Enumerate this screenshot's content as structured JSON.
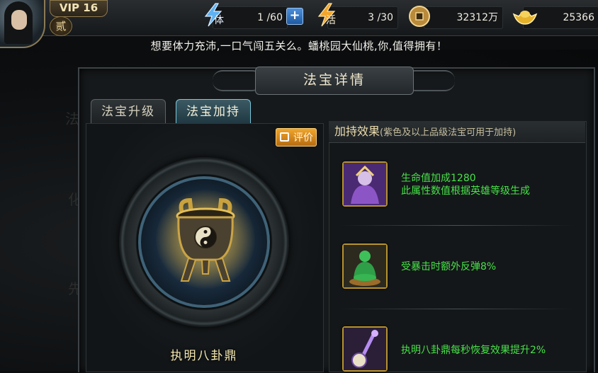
{
  "header": {
    "vip_label": "VIP 16",
    "rank_label": "贰",
    "stamina": {
      "icon": "stamina-bolt-icon",
      "label": "体",
      "value": "1 /60",
      "plus": "+"
    },
    "vigor": {
      "icon": "vigor-bolt-icon",
      "label": "活",
      "value": "3 /30"
    },
    "copper": {
      "icon": "copper-coin-icon",
      "value": "32312万"
    },
    "gold": {
      "icon": "gold-ingot-icon",
      "value": "25366"
    }
  },
  "marquee": "想要体力充沛,一口气闯五关么。蟠桃园大仙桃,你,值得拥有！",
  "background": {
    "left_labels": [
      "法",
      "化",
      "先"
    ]
  },
  "panel": {
    "title": "法宝详情",
    "tabs": [
      {
        "label": "法宝升级",
        "active": false
      },
      {
        "label": "法宝加持",
        "active": true
      }
    ],
    "rate_button": "评价",
    "item_name": "执明八卦鼎",
    "effects_header": "加持效果",
    "effects_note": "(紫色及以上品级法宝可用于加持)",
    "effects": [
      {
        "icon": "purple-hero-portrait-icon",
        "lines": [
          "生命值加成1280",
          "此属性数值根据英雄等级生成"
        ]
      },
      {
        "icon": "jade-buddha-statue-icon",
        "lines": [
          "受暴击时额外反弹8%"
        ]
      },
      {
        "icon": "bagua-staff-icon",
        "lines": [
          "执明八卦鼎每秒恢复效果提升2%"
        ]
      }
    ]
  },
  "colors": {
    "effect_text": "#48e24a",
    "item_name": "#f7e9b0",
    "active_tab_border": "#79c8dc",
    "rate_button": "#e39424"
  }
}
